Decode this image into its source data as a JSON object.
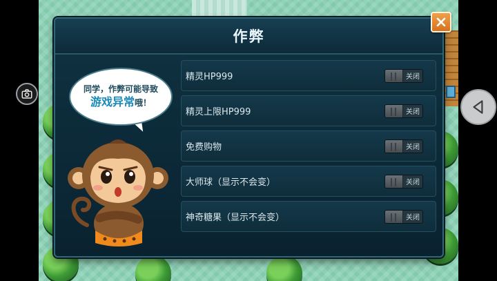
{
  "dialog": {
    "title": "作弊"
  },
  "bubble": {
    "line1": "同学，作弊可能导致",
    "line2_emphasis": "游戏异常",
    "line2_tail": "哦！"
  },
  "cheats": [
    {
      "label": "精灵HP999",
      "state": "关闭"
    },
    {
      "label": "精灵上限HP999",
      "state": "关闭"
    },
    {
      "label": "免费购物",
      "state": "关闭"
    },
    {
      "label": "大师球（显示不会变）",
      "state": "关闭"
    },
    {
      "label": "神奇糖果（显示不会变）",
      "state": "关闭"
    }
  ],
  "icons": {
    "close": "close-icon",
    "camera": "camera-icon",
    "back": "triangle-left-icon"
  },
  "colors": {
    "dialog_bg": "#0f3342",
    "close_button": "#e08a33",
    "title_text": "#eaf7ff"
  }
}
